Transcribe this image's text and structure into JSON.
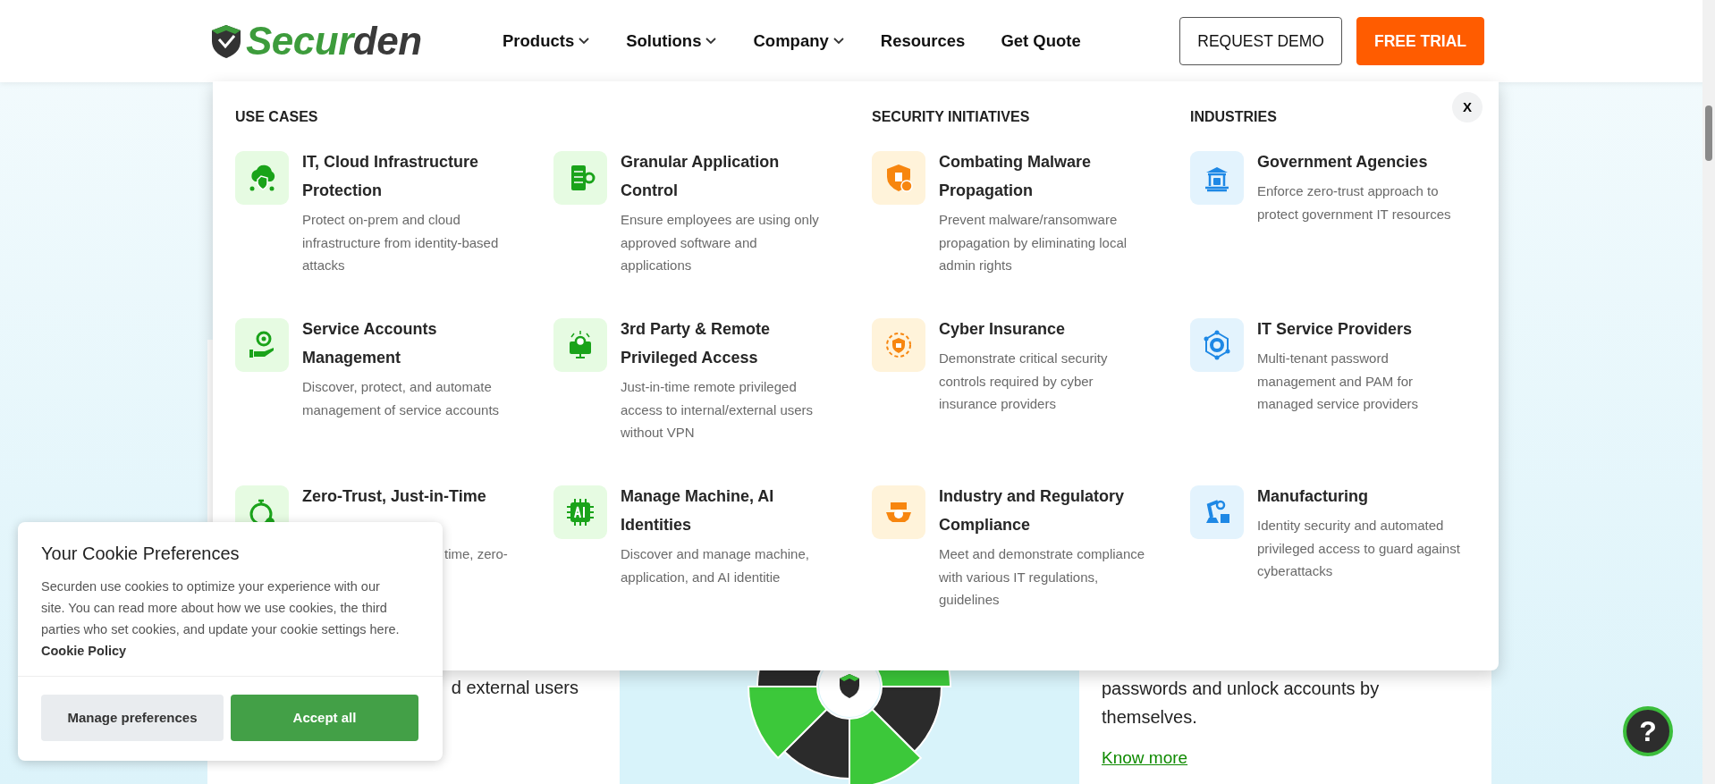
{
  "header": {
    "logo": {
      "parts": [
        "Secur",
        "den"
      ]
    },
    "nav": [
      {
        "label": "Products",
        "has_dropdown": true
      },
      {
        "label": "Solutions",
        "has_dropdown": true
      },
      {
        "label": "Company",
        "has_dropdown": true
      },
      {
        "label": "Resources",
        "has_dropdown": false
      },
      {
        "label": "Get Quote",
        "has_dropdown": false
      }
    ],
    "buttons": [
      {
        "label": "REQUEST DEMO",
        "kind": "outline"
      },
      {
        "label": "FREE TRIAL",
        "kind": "solid"
      }
    ]
  },
  "mega_menu": {
    "close": "X",
    "sections": [
      {
        "heading": "USE CASES",
        "color": "#1aa31a",
        "items": [
          {
            "title": "IT, Cloud Infrastructure Protection",
            "description": "Protect on-prem and cloud infrastructure from identity-based attacks"
          },
          {
            "title": "Granular Application Control",
            "description": "Ensure employees are using only approved software and applications"
          },
          {
            "title": "Service Accounts Management",
            "description": "Discover, protect, and automate management of service accounts"
          },
          {
            "title": "3rd Party & Remote Privileged Access",
            "description": "Just-in-time remote privileged access to internal/external users without VPN"
          },
          {
            "title": "Zero-Trust, Just-in-Time",
            "description": "time, zero-",
            "kind": "covered"
          },
          {
            "title": "Manage Machine, AI Identities",
            "description": "Discover and manage machine, application, and AI identitie"
          }
        ]
      },
      {
        "heading": "SECURITY INITIATIVES",
        "color": "#f7860f",
        "items": [
          {
            "title": "Combating Malware Propagation",
            "description": "Prevent malware/ransomware propagation by eliminating local admin rights"
          },
          {
            "title": "Cyber Insurance",
            "description": "Demonstrate critical security controls required by cyber insurance providers"
          },
          {
            "title": "Industry and Regulatory Compliance",
            "description": "Meet and demonstrate compliance with various IT regulations, guidelines"
          }
        ]
      },
      {
        "heading": "INDUSTRIES",
        "color": "#1e88e5",
        "items": [
          {
            "title": "Government Agencies",
            "description": "Enforce zero-trust approach to protect government IT resources"
          },
          {
            "title": "IT Service Providers",
            "description": "Multi-tenant password management and PAM for managed service providers"
          },
          {
            "title": "Manufacturing",
            "description": "Identity security and automated privileged access to guard against cyberattacks"
          }
        ]
      }
    ]
  },
  "page_cards": [
    {
      "text": "d external users"
    },
    {
      "kind": "picture"
    },
    {
      "text": "passwords and unlock accounts by themselves.",
      "link": "Know more"
    }
  ],
  "cookie_banner": {
    "title": "Your Cookie Preferences",
    "text": "Securden use cookies to optimize your experience with our site. You can read more about how we use cookies, the third parties who set cookies, and update your cookie settings here.",
    "link": "Cookie Policy",
    "buttons": [
      {
        "label": "Manage preferences",
        "kind": "secondary"
      },
      {
        "label": "Accept all",
        "kind": "primary"
      }
    ]
  },
  "help_button": {
    "label": "?"
  }
}
